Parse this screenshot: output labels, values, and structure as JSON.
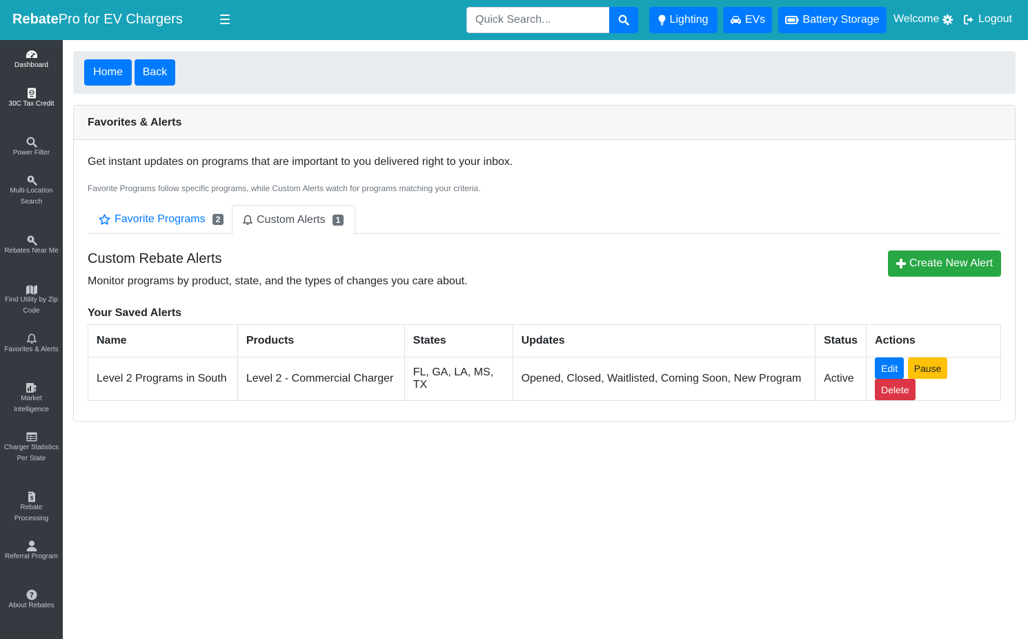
{
  "app": {
    "brand_bold": "Rebate",
    "brand_rest": "Pro for EV Chargers"
  },
  "topnav": {
    "search_placeholder": "Quick Search...",
    "lighting": "Lighting",
    "evs": "EVs",
    "battery": "Battery Storage",
    "welcome": "Welcome",
    "logout": "Logout"
  },
  "sidebar": {
    "items": [
      {
        "label": "Dashboard",
        "icon": "gauge-icon"
      },
      {
        "label": "30C Tax Credit",
        "icon": "passport-icon"
      },
      {
        "label": "Power Filter",
        "icon": "search-icon"
      },
      {
        "label": "Multi-Location Search",
        "icon": "search-location-icon"
      },
      {
        "label": "Rebates Near Me",
        "icon": "search-location-icon"
      },
      {
        "label": "Find Utility by Zip Code",
        "icon": "map-icon"
      },
      {
        "label": "Favorites & Alerts",
        "icon": "bell-icon"
      },
      {
        "label": "Market Intelligence",
        "icon": "chart-icon"
      },
      {
        "label": "Charger Statistics Per State",
        "icon": "table-icon"
      },
      {
        "label": "Rebate Processing",
        "icon": "file-invoice-icon"
      },
      {
        "label": "Referral Program",
        "icon": "user-icon"
      },
      {
        "label": "About Rebates",
        "icon": "question-icon"
      }
    ]
  },
  "breadcrumb": {
    "home": "Home",
    "back": "Back"
  },
  "card": {
    "header": "Favorites & Alerts",
    "intro": "Get instant updates on programs that are important to you delivered right to your inbox.",
    "note": "Favorite Programs follow specific programs, while Custom Alerts watch for programs matching your criteria."
  },
  "tabs": [
    {
      "label": "Favorite Programs",
      "count": "2"
    },
    {
      "label": "Custom Alerts",
      "count": "1"
    }
  ],
  "alerts_section": {
    "title": "Custom Rebate Alerts",
    "subtitle": "Monitor programs by product, state, and the types of changes you care about.",
    "create_label": "Create New Alert",
    "saved_title": "Your Saved Alerts"
  },
  "table": {
    "headers": [
      "Name",
      "Products",
      "States",
      "Updates",
      "Status",
      "Actions"
    ],
    "rows": [
      {
        "name": "Level 2 Programs in South",
        "products": "Level 2 - Commercial Charger",
        "states": "FL, GA, LA, MS, TX",
        "updates": "Opened, Closed, Waitlisted, Coming Soon, New Program",
        "status": "Active",
        "edit": "Edit",
        "pause": "Pause",
        "delete": "Delete"
      }
    ]
  },
  "colors": {
    "navbar": "#17a2b8",
    "primary": "#007bff",
    "success": "#28a745",
    "warning": "#ffc107",
    "danger": "#dc3545",
    "sidebar": "#343a40"
  }
}
